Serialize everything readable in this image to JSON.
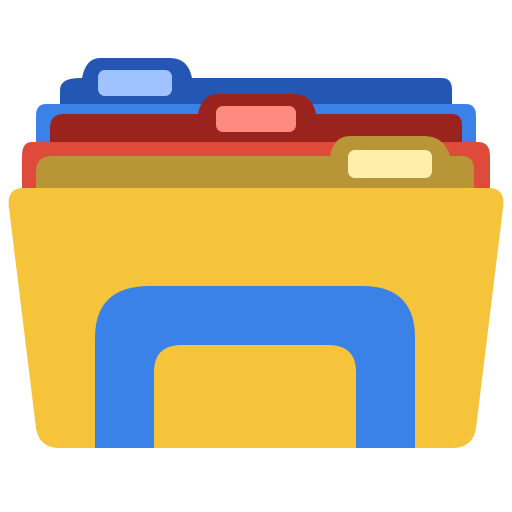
{
  "icon": {
    "name": "file-explorer-folder-icon",
    "colors": {
      "back_blue_dark": "#2457B3",
      "back_blue_light": "#3B82E8",
      "tab_blue": "#9FC3FF",
      "mid_red_dark": "#9B231D",
      "mid_red_light": "#E04A3B",
      "tab_red": "#FF8A80",
      "front_olive": "#B89637",
      "tab_cream": "#FFEFAA",
      "folder_yellow": "#F6C43B",
      "arch_blue": "#3B82E8",
      "inner_yellow": "#F6C43B"
    }
  }
}
